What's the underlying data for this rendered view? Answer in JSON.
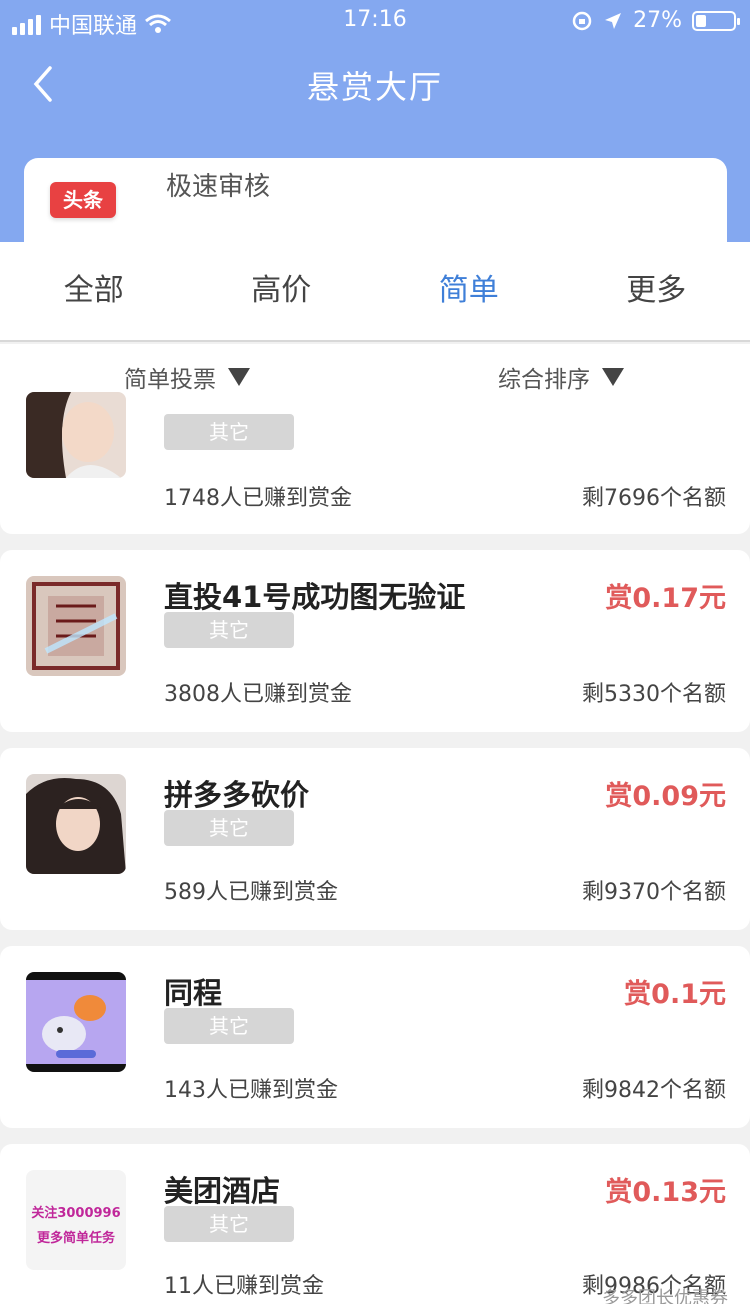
{
  "status_bar": {
    "carrier": "中国联通",
    "time": "17:16",
    "battery": "27%"
  },
  "header": {
    "title": "悬赏大厅"
  },
  "featured": {
    "badge": "头条",
    "title": "极速审核"
  },
  "tabs": [
    {
      "label": "全部"
    },
    {
      "label": "高价"
    },
    {
      "label": "简单"
    },
    {
      "label": "更多"
    }
  ],
  "active_tab": "简单",
  "filters": {
    "category": "简单投票",
    "sort": "综合排序"
  },
  "tasks": [
    {
      "title": "",
      "tag": "其它",
      "earned": "1748人已赚到赏金",
      "remaining": "剩7696个名额",
      "reward": ""
    },
    {
      "title": "直投41号成功图无验证",
      "tag": "其它",
      "earned": "3808人已赚到赏金",
      "remaining": "剩5330个名额",
      "reward": "赏0.17元"
    },
    {
      "title": "拼多多砍价",
      "tag": "其它",
      "earned": "589人已赚到赏金",
      "remaining": "剩9370个名额",
      "reward": "赏0.09元"
    },
    {
      "title": "同程",
      "tag": "其它",
      "earned": "143人已赚到赏金",
      "remaining": "剩9842个名额",
      "reward": "赏0.1元"
    },
    {
      "title": "美团酒店",
      "tag": "其它",
      "earned": "11人已赚到赏金",
      "remaining": "剩9986个名额",
      "reward": "赏0.13元",
      "thumb_text": [
        "关注3000996",
        "更多简单任务"
      ]
    }
  ],
  "watermark": "多多团长优惠券",
  "colors": {
    "header_bg": "#84a8f0",
    "active_tab": "#3f7fd8",
    "reward": "#e05a5a",
    "badge": "#e84142"
  }
}
